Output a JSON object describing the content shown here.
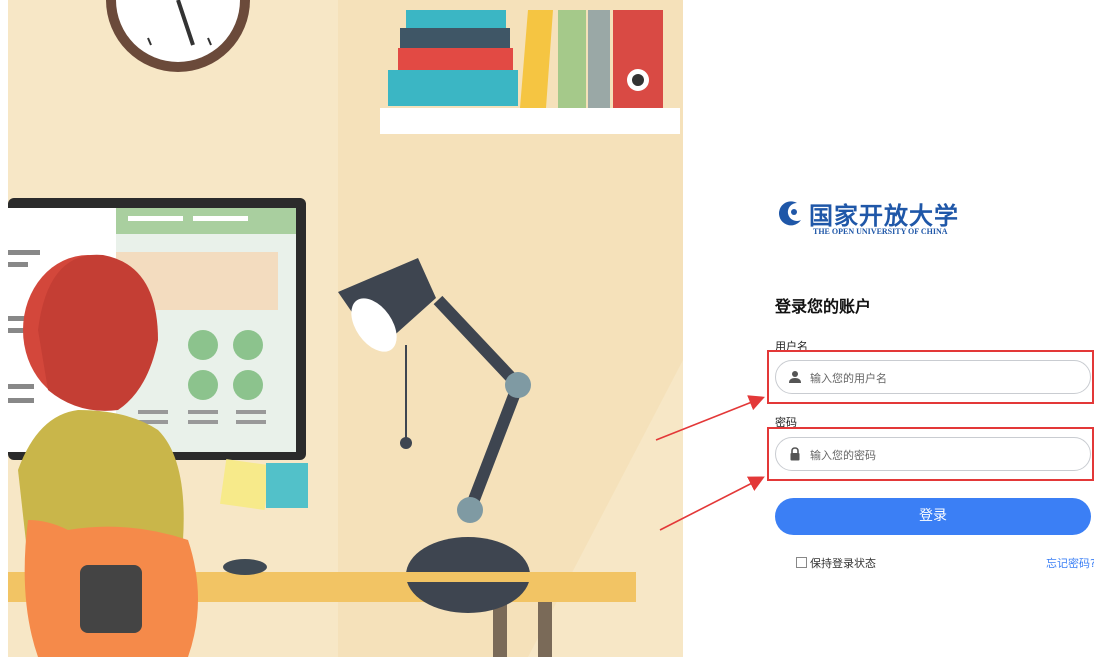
{
  "logo": {
    "name_cn": "国家开放大学",
    "name_en": "THE OPEN UNIVERSITY OF CHINA"
  },
  "form": {
    "heading": "登录您的账户",
    "username": {
      "label": "用户名",
      "placeholder": "输入您的用户名",
      "icon": "user-icon"
    },
    "password": {
      "label": "密码",
      "placeholder": "输入您的密码",
      "icon": "lock-icon"
    },
    "submit_label": "登录",
    "remember_label": "保持登录状态",
    "remember_checked": false,
    "forgot_label": "忘记密码?"
  },
  "colors": {
    "brand": "#1f57a8",
    "button": "#3b7ff5",
    "annotation": "#e33838"
  }
}
